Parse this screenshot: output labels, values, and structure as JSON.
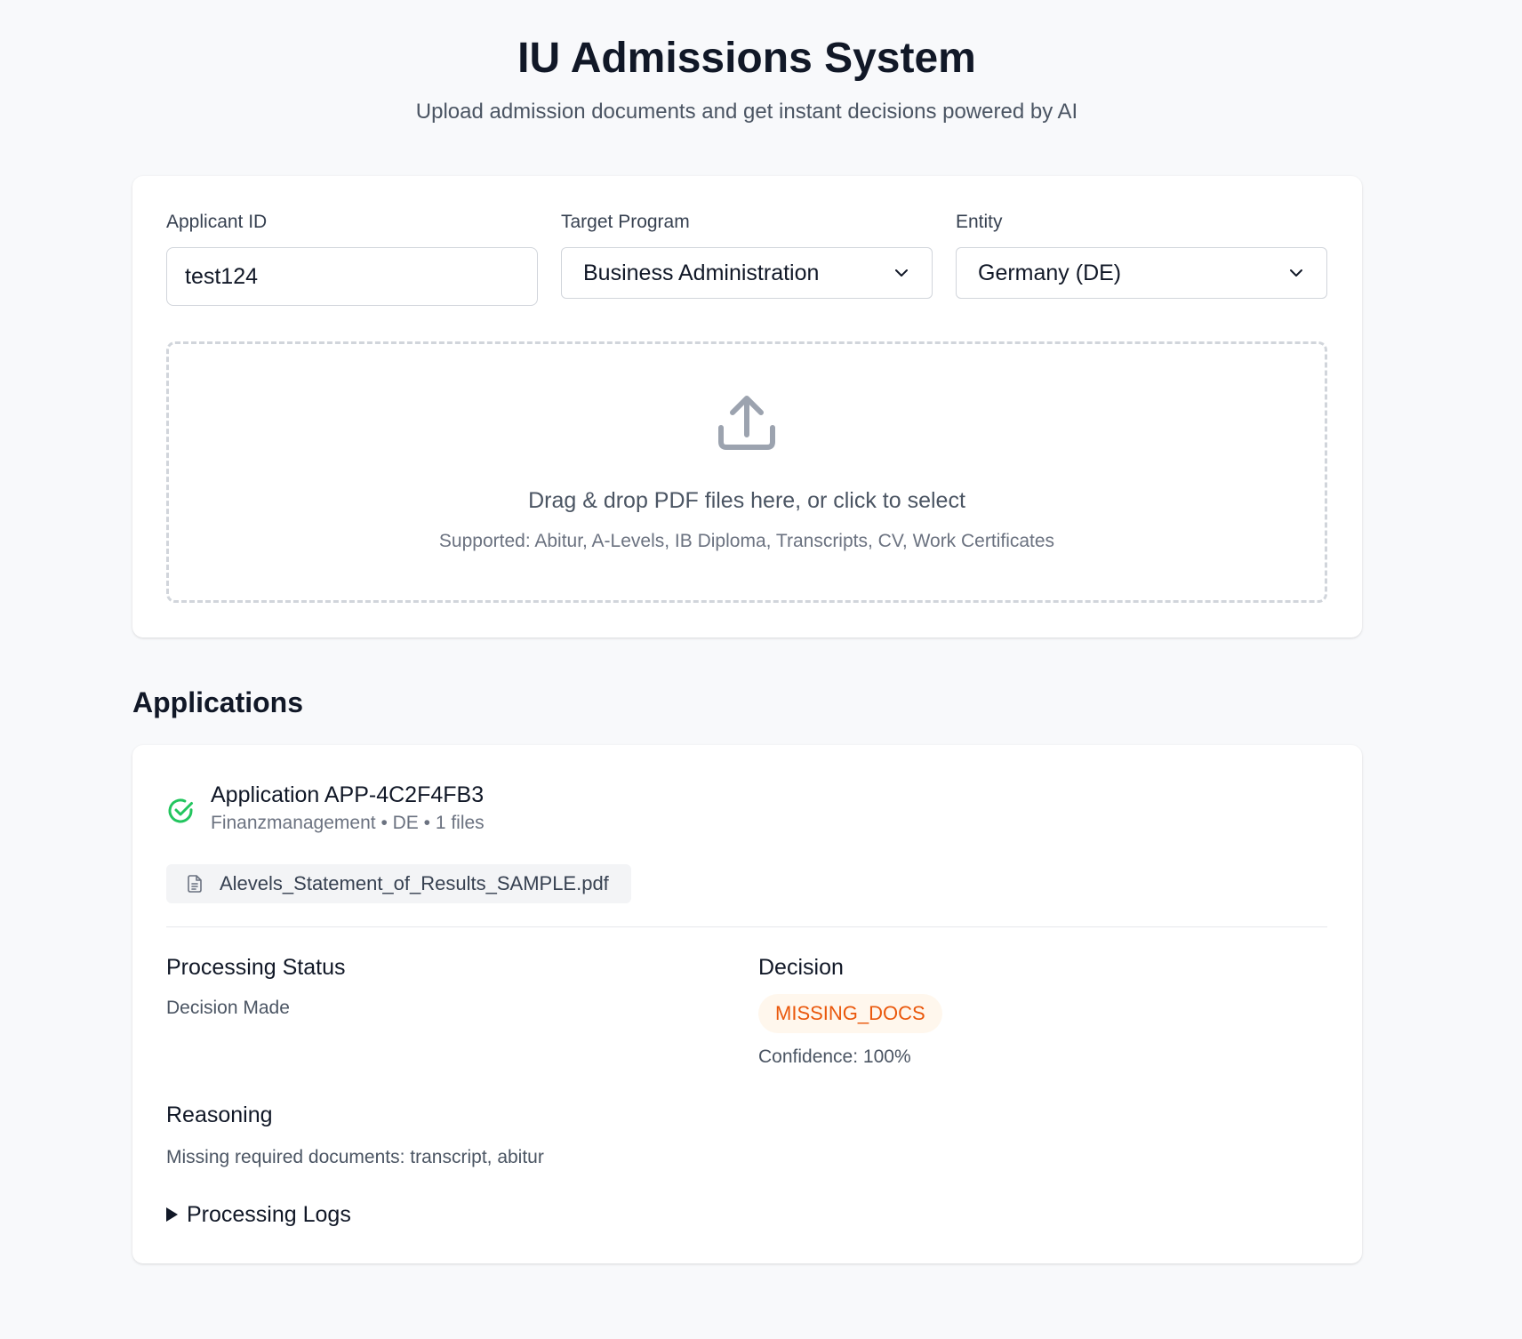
{
  "header": {
    "title": "IU Admissions System",
    "subtitle": "Upload admission documents and get instant decisions powered by AI"
  },
  "form": {
    "applicant_id_label": "Applicant ID",
    "applicant_id_value": "test124",
    "program_label": "Target Program",
    "program_value": "Business Administration",
    "entity_label": "Entity",
    "entity_value": "Germany (DE)"
  },
  "dropzone": {
    "icon": "upload-icon",
    "title": "Drag & drop PDF files here, or click to select",
    "subtitle": "Supported: Abitur, A-Levels, IB Diploma, Transcripts, CV, Work Certificates"
  },
  "applications": {
    "section_title": "Applications",
    "items": [
      {
        "status_icon": "check-circle-icon",
        "title": "Application APP-4C2F4FB3",
        "meta": "Finanzmanagement • DE • 1 files",
        "files": [
          "Alevels_Statement_of_Results_SAMPLE.pdf"
        ],
        "processing_status_label": "Processing Status",
        "processing_status_value": "Decision Made",
        "decision_label": "Decision",
        "decision_value": "MISSING_DOCS",
        "confidence": "Confidence: 100%",
        "reasoning_label": "Reasoning",
        "reasoning_value": "Missing required documents: transcript, abitur",
        "logs_label": "Processing Logs"
      }
    ]
  },
  "colors": {
    "background": "#f8f9fb",
    "success": "#22c55e",
    "badge_text": "#ea580c",
    "badge_bg": "#fff7ed"
  }
}
